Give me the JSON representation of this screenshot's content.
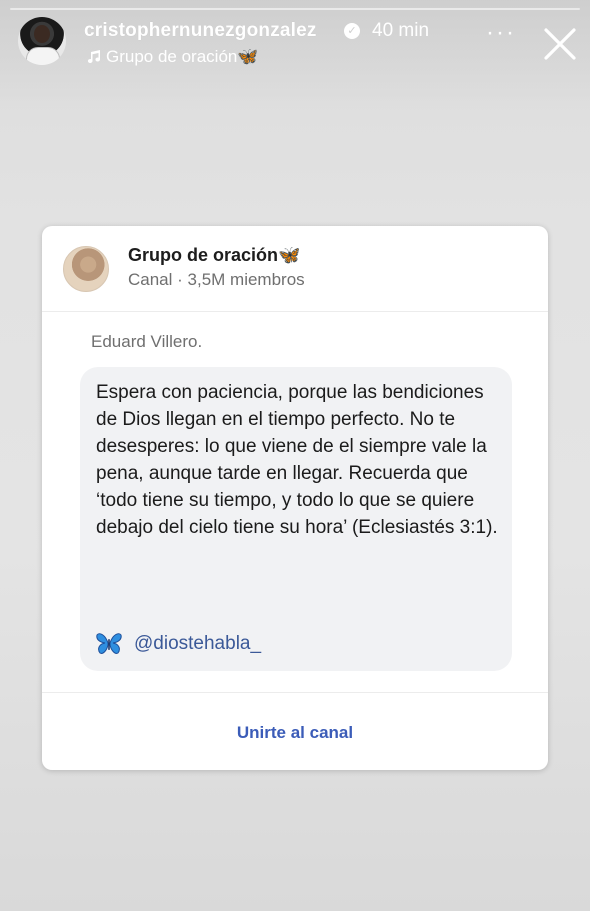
{
  "story": {
    "username": "cristophernunezgonzalez",
    "time": "40 min",
    "subtitle": "Grupo de oración🦋",
    "more_label": "···",
    "close_label": "✕"
  },
  "card": {
    "channel_name": "Grupo de oración🦋",
    "channel_meta": "Canal · 3,5M miembros",
    "author": "Eduard Villero.",
    "message": "Espera con paciencia, porque las bendiciones de Dios llegan en el tiempo perfecto. No te desesperes: lo que viene de el siempre vale la pena, aunque tarde en llegar. Recuerda que ‘todo tiene su tiempo, y todo lo que se quiere debajo del cielo tiene su hora’ (Eclesiastés 3:1).",
    "handle": "@diostehabla_",
    "join_label": "Unirte al canal"
  },
  "colors": {
    "accent": "#3b5cb8",
    "bubble": "#f1f2f4",
    "butterfly": "#2f8fe0"
  },
  "icons": {
    "verified": "verified-badge-icon",
    "music": "music-note-icon",
    "more": "more-dots-icon",
    "close": "close-icon",
    "butterfly": "butterfly-icon"
  }
}
